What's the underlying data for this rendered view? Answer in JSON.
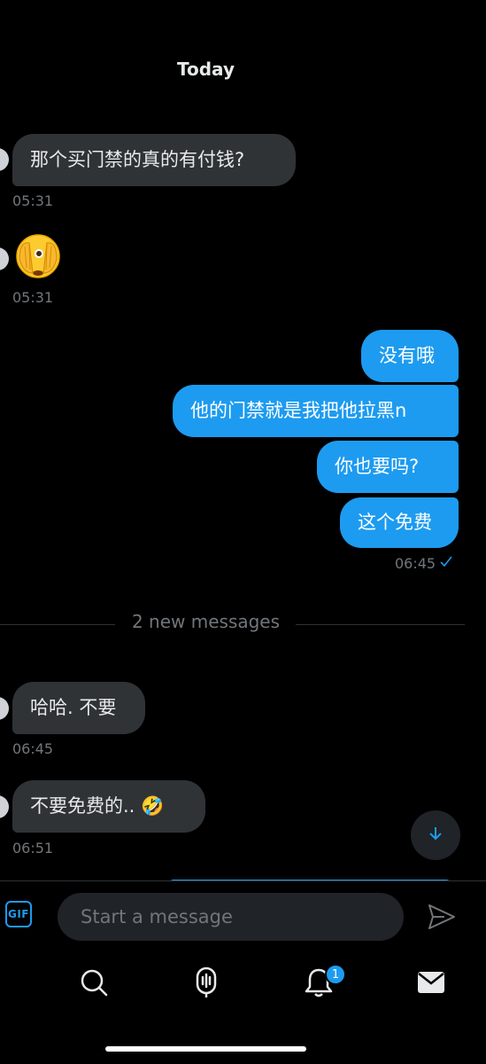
{
  "conversation": {
    "date_header": "Today",
    "new_messages_divider": "2 new messages",
    "messages": [
      {
        "direction": "incoming",
        "text": "那个买门禁的真的有付钱?"
      },
      {
        "direction": "incoming",
        "emoji": "face-with-peeking-eye"
      },
      {
        "direction": "outgoing",
        "text": "没有哦"
      },
      {
        "direction": "outgoing",
        "text": "他的门禁就是我把他拉黑n"
      },
      {
        "direction": "outgoing",
        "text": "你也要吗?"
      },
      {
        "direction": "outgoing",
        "text": "这个免费"
      },
      {
        "direction": "incoming",
        "text": "哈哈. 不要"
      },
      {
        "direction": "incoming",
        "text": "不要免费的.. 🤣"
      }
    ],
    "timestamps": {
      "t1": "05:31",
      "t2": "05:31",
      "t3": "06:45",
      "t4": "06:45",
      "t5": "06:51"
    },
    "read_receipt_icon": "check-icon"
  },
  "composer": {
    "gif_label": "GIF",
    "placeholder": "Start a message",
    "value": ""
  },
  "tab_bar": {
    "tabs": [
      "search",
      "spaces",
      "notifications",
      "messages"
    ],
    "notifications_badge": "1"
  },
  "colors": {
    "accent": "#1d9bf0",
    "incoming_bubble": "#2f3336",
    "background": "#000000",
    "secondary_text": "#71767b"
  }
}
